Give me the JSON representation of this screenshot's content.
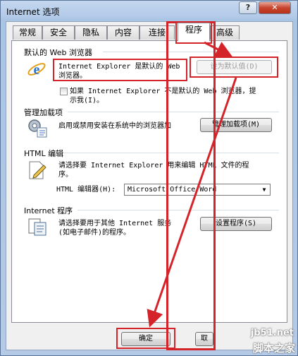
{
  "window": {
    "title": "Internet 选项",
    "help_label": "?",
    "close_label": "✕"
  },
  "tabs": [
    "常规",
    "安全",
    "隐私",
    "内容",
    "连接",
    "程序",
    "高级"
  ],
  "active_tab": "程序",
  "web_browser": {
    "group_title": "默认的 Web 浏览器",
    "status_line1": "Internet Explorer 是默认的 Web",
    "status_line2": "浏览器。",
    "set_default_button": "设为默认值(D)",
    "check_line1": "如果 Internet Explorer 不是默认的 Web 浏览器，提",
    "check_line2": "示我(I)。"
  },
  "addons": {
    "group_title": "管理加载项",
    "description": "启用或禁用安装在系统中的浏览器加",
    "button": "管理加载项(M)"
  },
  "html_editor": {
    "group_title": "HTML 编辑",
    "description_line1": "请选择要 Internet Explorer 用来编辑 HTML 文件的程",
    "description_line2": "序。",
    "select_label": "HTML 编辑器(H):",
    "select_value": "Microsoft Office Word"
  },
  "internet_programs": {
    "group_title": "Internet 程序",
    "description_line1": "请选择要用于其他 Internet 服务",
    "description_line2": "(如电子邮件)的程序。",
    "button": "设置程序(S)"
  },
  "footer": {
    "ok_button": "确定",
    "cancel_partial": "取"
  },
  "watermark": {
    "line1": "jb51.net",
    "line2": "脚本之家"
  },
  "colors": {
    "annotation": "#d4242a"
  }
}
